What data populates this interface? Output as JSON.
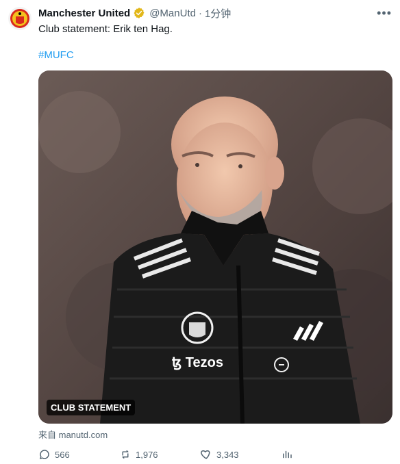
{
  "tweet": {
    "author_name": "Manchester United",
    "handle": "@ManUtd",
    "separator": "·",
    "time": "1分钟",
    "text": "Club statement: Erik ten Hag.",
    "hashtag": "#MUFC",
    "media_badge": "CLUB STATEMENT",
    "source": "来自 manutd.com",
    "replies": "566",
    "retweets": "1,976",
    "likes": "3,343"
  },
  "colors": {
    "link": "#1d9bf0",
    "muted": "#536471",
    "verified": "#e2b719"
  },
  "icons": [
    "club-crest-icon",
    "verified-badge-icon",
    "more-icon",
    "reply-icon",
    "retweet-icon",
    "like-icon",
    "views-icon"
  ]
}
